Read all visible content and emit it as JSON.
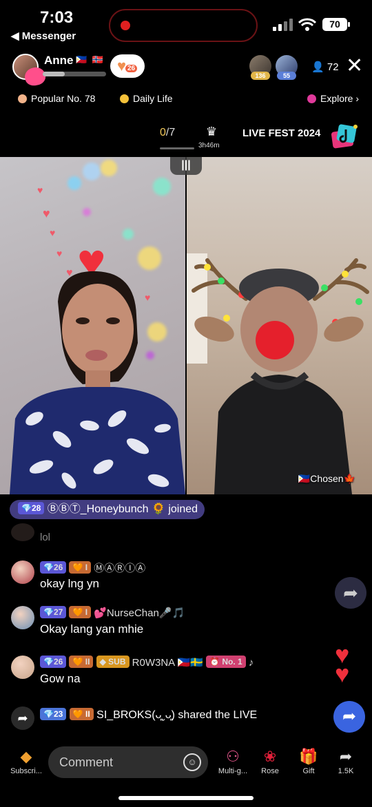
{
  "status_bar": {
    "time": "7:03",
    "back_app": "◀ Messenger",
    "battery": "70"
  },
  "host": {
    "name": "Anne",
    "flags": "🇵🇭 🇳🇴",
    "follow_count": "26",
    "progress_fraction": 0.35
  },
  "viewers": {
    "top": [
      {
        "badge": "136",
        "color": "#e2b64a"
      },
      {
        "badge": "55",
        "color": "#5b7fd8"
      }
    ],
    "count": "72"
  },
  "tags": {
    "popular": "Popular No. 78",
    "daily": "Daily Life",
    "explore": "Explore ›",
    "popular_color": "#f2b38a",
    "daily_color": "#f5c23a",
    "explore_color": "#e03a9b"
  },
  "fest": {
    "progress_current": "0",
    "progress_total": "/7",
    "timer": "3h46m",
    "title": "LIVE FEST 2024"
  },
  "video": {
    "split_icon": "|||",
    "right_label": "🇵🇭Chosen🍁"
  },
  "chat": {
    "join": {
      "level": "💎28",
      "user": "ⒷⒷⓉ_Honeybunch 🌻",
      "action": "joined"
    },
    "faded": "lol",
    "messages": [
      {
        "level": "💎26",
        "fan_level": "🧡 I",
        "user": "ⓂⒶⓇⒾⒶ",
        "text": "okay lng yn",
        "avatar_color": "#b0404a"
      },
      {
        "level": "💎27",
        "fan_level": "🧡 I",
        "user": "💕NurseChan🎤🎵",
        "text": "Okay lang yan mhie",
        "avatar_color": "#6a8fb5"
      },
      {
        "level": "💎26",
        "fan_level": "🧡 II",
        "sub": "◆ SUB",
        "user": "R0W3NA 🇵🇭🇸🇪",
        "rank": "⏰ No. 1",
        "extra": "♪",
        "text": "Gow na",
        "avatar_color": "#c9a58a"
      }
    ],
    "share": {
      "level": "💎23",
      "fan_level": "🧡 II",
      "user": "SI_BROKS(ᴗ͈ˬᴗ͈)",
      "action": "shared the LIVE"
    }
  },
  "bottom_bar": {
    "subscribe": "Subscri...",
    "comment_placeholder": "Comment",
    "multi_guest": "Multi-g...",
    "rose": "Rose",
    "gift": "Gift",
    "share_count": "1.5K"
  }
}
